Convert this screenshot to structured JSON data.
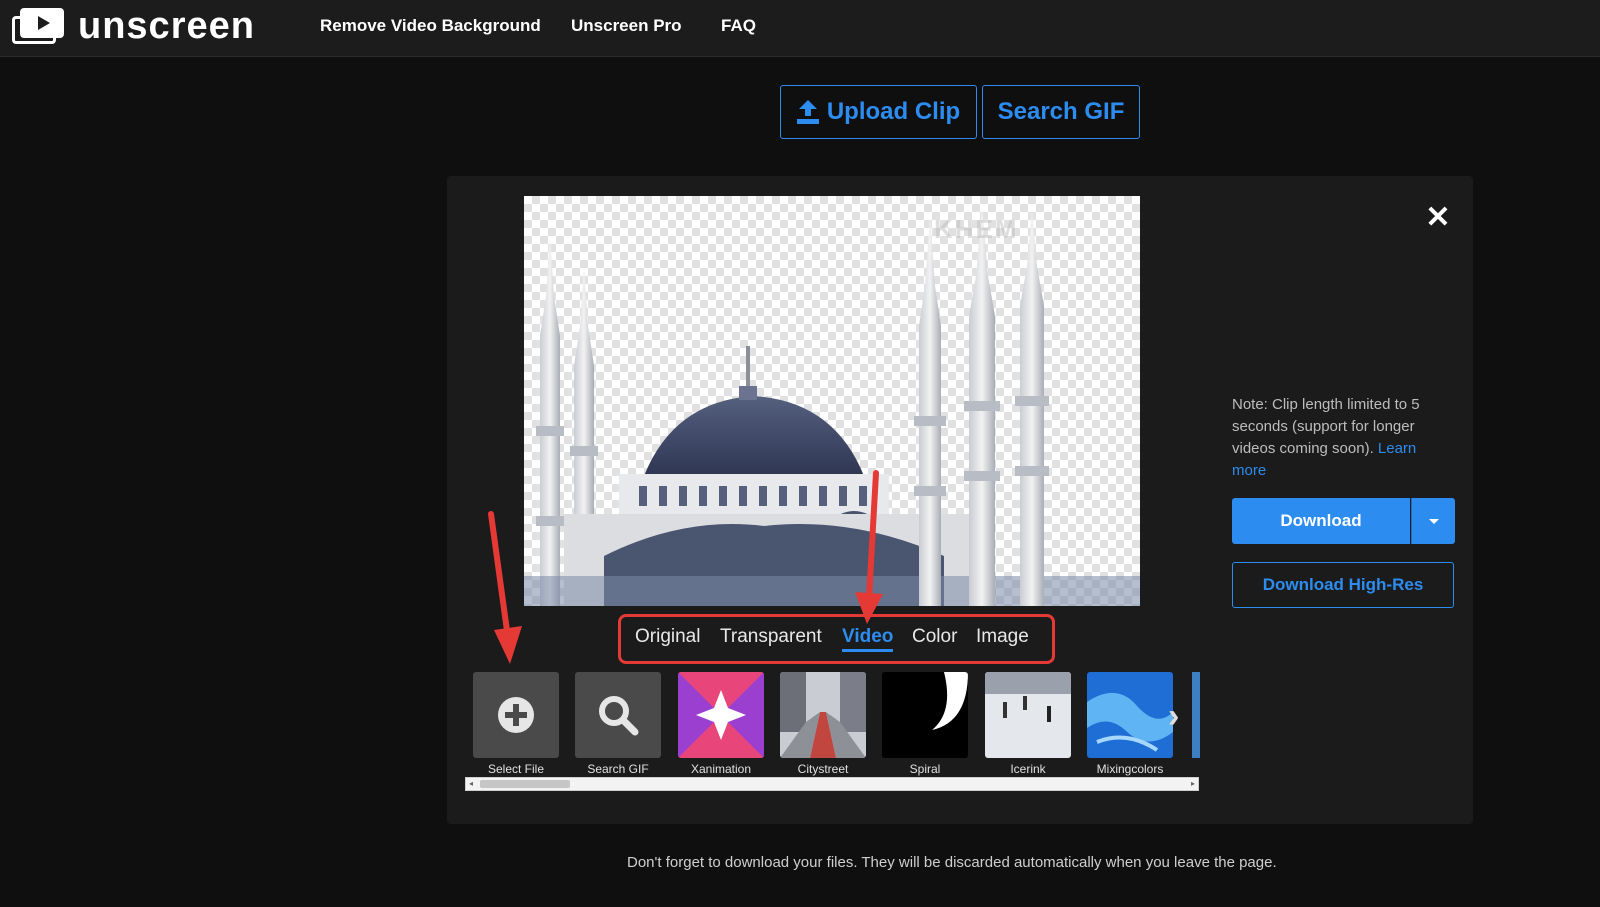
{
  "app": {
    "logo_text": "unscreen"
  },
  "nav": {
    "items": [
      "Remove Video Background",
      "Unscreen Pro",
      "FAQ"
    ]
  },
  "top_buttons": {
    "upload_label": "Upload Clip",
    "search_label": "Search GIF"
  },
  "preview": {
    "watermark": "KHEM"
  },
  "note": {
    "text": "Note: Clip length limited to 5 seconds (support for longer videos coming soon). ",
    "link": "Learn more"
  },
  "download": {
    "label": "Download",
    "highres_label": "Download High-Res"
  },
  "background_tabs": {
    "items": [
      "Original",
      "Transparent",
      "Video",
      "Color",
      "Image"
    ],
    "active": "Video"
  },
  "thumbnails": {
    "items": [
      "Select File",
      "Search GIF",
      "Xanimation",
      "Citystreet",
      "Spiral",
      "Icerink",
      "Mixingcolors"
    ]
  },
  "footer": {
    "text": "Don't forget to download your files. They will be discarded automatically when you leave the page."
  },
  "colors": {
    "accent": "#2d8cf0",
    "annotation": "#e53935",
    "background": "#0f0f0f",
    "panel": "#1b1b1b"
  }
}
